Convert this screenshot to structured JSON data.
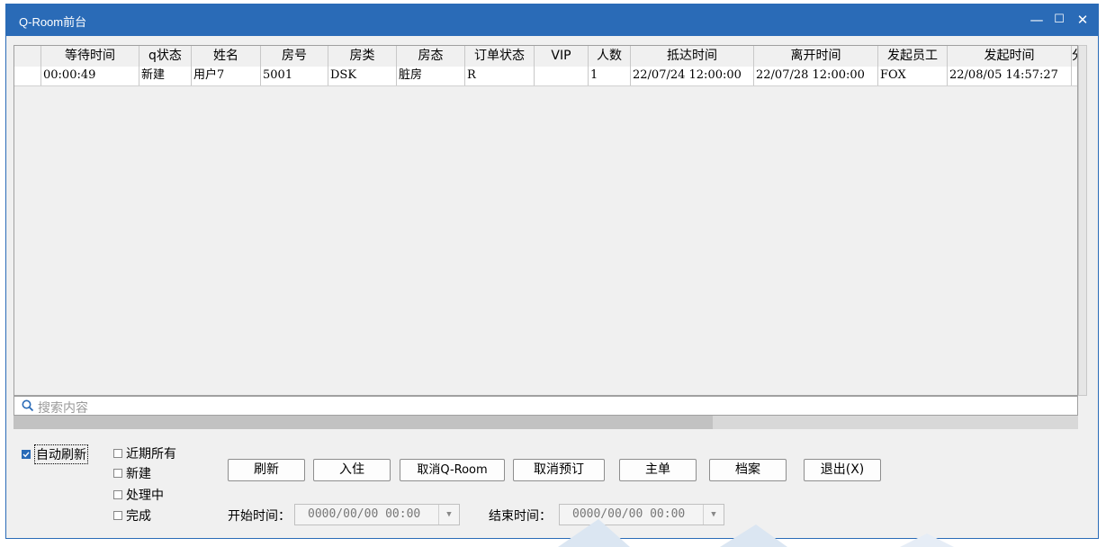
{
  "window": {
    "title": "Q-Room前台",
    "controls": {
      "minimize": "—",
      "maximize": "☐",
      "close": "✕"
    }
  },
  "table": {
    "headers": [
      "",
      "等待时间",
      "q状态",
      "姓名",
      "房号",
      "房类",
      "房态",
      "订单状态",
      "VIP",
      "人数",
      "抵达时间",
      "离开时间",
      "发起员工",
      "发起时间",
      "分"
    ],
    "rows": [
      [
        "",
        "00:00:49",
        "新建",
        "用户7",
        "5001",
        "DSK",
        "脏房",
        "R",
        "",
        "1",
        "22/07/24 12:00:00",
        "22/07/28 12:00:00",
        "FOX",
        "22/08/05 14:57:27",
        ""
      ]
    ]
  },
  "search": {
    "placeholder": "搜索内容"
  },
  "filters": {
    "auto_refresh": {
      "label": "自动刷新",
      "checked": true
    },
    "recent_all": {
      "label": "近期所有",
      "checked": false
    },
    "new": {
      "label": "新建",
      "checked": false
    },
    "processing": {
      "label": "处理中",
      "checked": false
    },
    "done": {
      "label": "完成",
      "checked": false
    }
  },
  "buttons": {
    "refresh": "刷新",
    "checkin": "入住",
    "cancel_qroom": "取消Q-Room",
    "cancel_booking": "取消预订",
    "master": "主单",
    "profile": "档案",
    "exit": "退出(X)"
  },
  "time_range": {
    "start_label": "开始时间：",
    "start_value": "0000/00/00 00:00",
    "end_label": "结束时间：",
    "end_value": "0000/00/00 00:00"
  }
}
